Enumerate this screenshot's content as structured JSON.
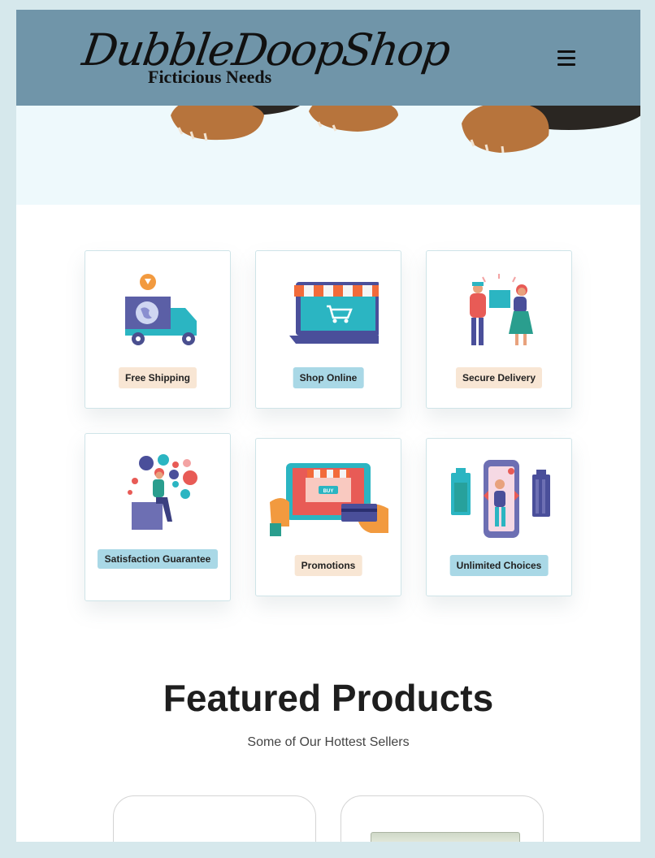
{
  "header": {
    "logo_title": "DubbleDoopShop",
    "logo_subtitle": "Ficticious Needs",
    "menu_icon": "hamburger-menu-icon"
  },
  "features": [
    {
      "label": "Free Shipping",
      "icon": "delivery-truck-icon",
      "chip_color": "#f8e6d4"
    },
    {
      "label": "Shop Online",
      "icon": "laptop-shop-icon",
      "chip_color": "#a9d8e6"
    },
    {
      "label": "Secure Delivery",
      "icon": "package-handoff-icon",
      "chip_color": "#f8e6d4"
    },
    {
      "label": "Satisfaction Guarantee",
      "icon": "social-bubbles-icon",
      "chip_color": "#a9d8e6"
    },
    {
      "label": "Promotions",
      "icon": "tablet-buy-icon",
      "chip_color": "#f8e6d4"
    },
    {
      "label": "Unlimited Choices",
      "icon": "battery-choices-icon",
      "chip_color": "#a9d8e6"
    }
  ],
  "featured": {
    "title": "Featured Products",
    "subtitle": "Some of Our Hottest Sellers"
  },
  "colors": {
    "header_bg": "#7095a9",
    "page_bg": "#d6e8ec",
    "hero_bg": "#eef9fc"
  }
}
